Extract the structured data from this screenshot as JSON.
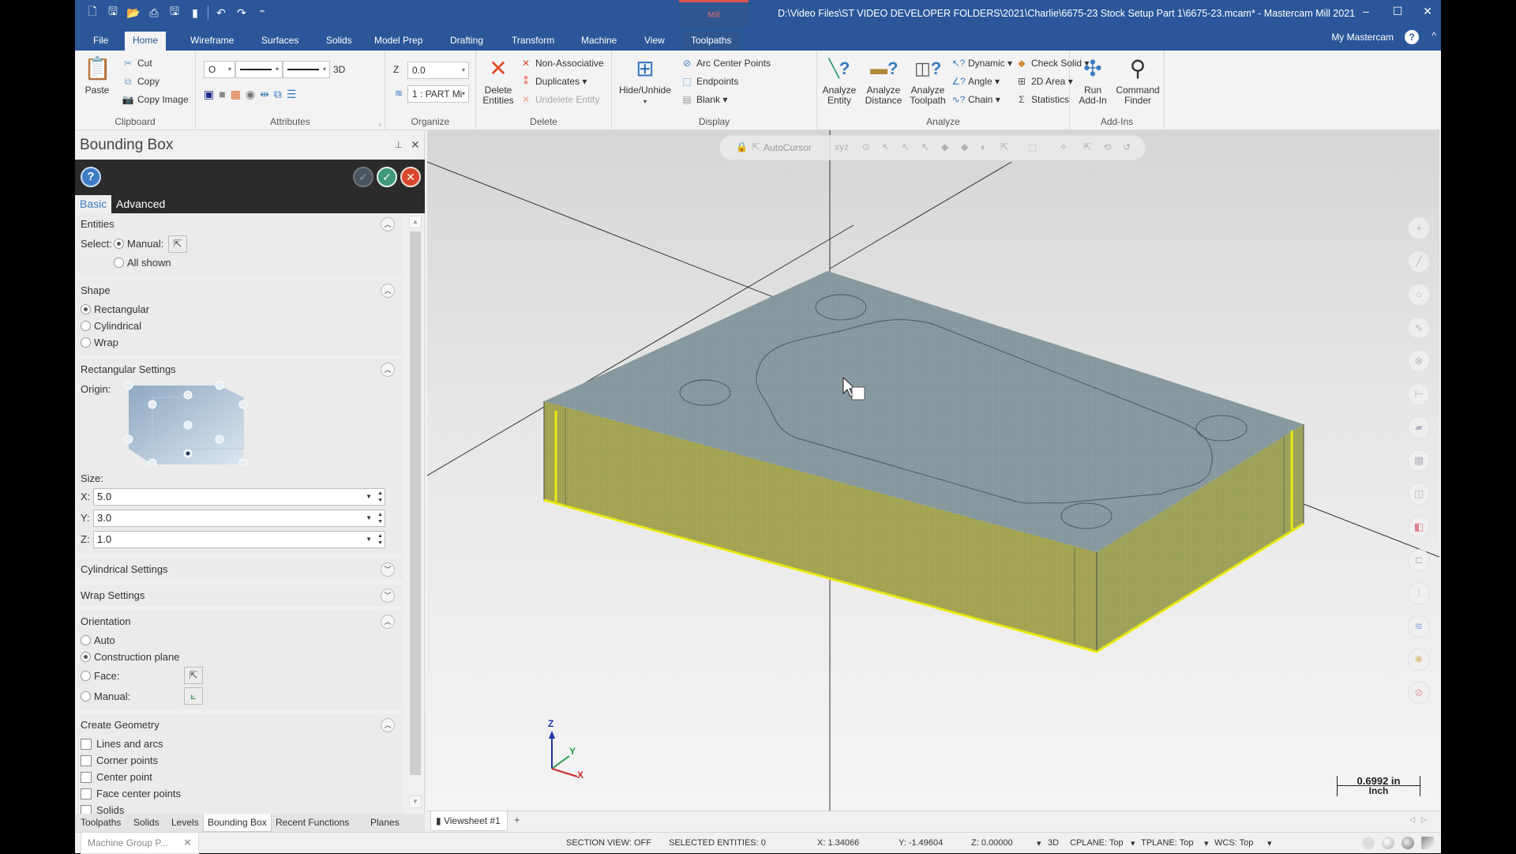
{
  "window": {
    "title": "D:\\Video Files\\ST VIDEO DEVELOPER FOLDERS\\2021\\Charlie\\6675-23 Stock Setup Part 1\\6675-23.mcam* - Mastercam Mill 2021",
    "context_tab": "Mill",
    "minimize": "–",
    "maximize": "☐",
    "close": "✕"
  },
  "quick_access": [
    "new-file-icon",
    "save-icon",
    "open-icon",
    "print-icon",
    "save-as-icon",
    "send-icon",
    "undo-icon",
    "redo-icon",
    "customize-icon"
  ],
  "ribbon_tabs": [
    {
      "label": "File",
      "active": false
    },
    {
      "label": "Home",
      "active": true
    },
    {
      "label": "Wireframe",
      "active": false
    },
    {
      "label": "Surfaces",
      "active": false
    },
    {
      "label": "Solids",
      "active": false
    },
    {
      "label": "Model Prep",
      "active": false
    },
    {
      "label": "Drafting",
      "active": false
    },
    {
      "label": "Transform",
      "active": false
    },
    {
      "label": "Machine",
      "active": false
    },
    {
      "label": "View",
      "active": false
    },
    {
      "label": "Toolpaths",
      "active": false
    }
  ],
  "ribbon_right": {
    "my_mastercam": "My Mastercam",
    "help": "?",
    "collapse": "^"
  },
  "ribbon": {
    "clipboard": {
      "label": "Clipboard",
      "paste": "Paste",
      "cut": "Cut",
      "copy": "Copy",
      "copy_image": "Copy Image"
    },
    "attributes": {
      "label": "Attributes",
      "point_style": "O",
      "dimension_mode": "3D"
    },
    "organize": {
      "label": "Organize",
      "z_label": "Z",
      "z_value": "0.0",
      "level_value": "1 : PART Mi"
    },
    "delete": {
      "label": "Delete",
      "delete_entities": "Delete Entities",
      "non_associative": "Non-Associative",
      "duplicates": "Duplicates",
      "undelete": "Undelete Entity"
    },
    "display": {
      "label": "Display",
      "hide_unhide": "Hide/Unhide",
      "arc_center": "Arc Center Points",
      "endpoints": "Endpoints",
      "blank": "Blank"
    },
    "analyze": {
      "label": "Analyze",
      "entity": "Analyze Entity",
      "distance": "Analyze Distance",
      "toolpath": "Analyze Toolpath",
      "dynamic": "Dynamic",
      "angle": "Angle",
      "chain": "Chain",
      "check_solid": "Check Solid",
      "area_2d": "2D Area",
      "statistics": "Statistics"
    },
    "addins": {
      "label": "Add-Ins",
      "run_addin": "Run Add-In",
      "command_finder": "Command Finder"
    }
  },
  "panel": {
    "title": "Bounding Box",
    "pin": "⊥",
    "close": "✕",
    "help": "?",
    "tabs": [
      {
        "label": "Basic",
        "active": true
      },
      {
        "label": "Advanced",
        "active": false
      }
    ],
    "entities": {
      "title": "Entities",
      "select_label": "Select:",
      "manual": "Manual:",
      "all_shown": "All shown",
      "selected": "manual"
    },
    "shape": {
      "title": "Shape",
      "options": [
        "Rectangular",
        "Cylindrical",
        "Wrap"
      ],
      "selected": "Rectangular"
    },
    "rectangular": {
      "title": "Rectangular Settings",
      "origin_label": "Origin:",
      "size_label": "Size:",
      "x_label": "X:",
      "x_value": "5.0",
      "y_label": "Y:",
      "y_value": "3.0",
      "z_label": "Z:",
      "z_value": "1.0"
    },
    "cylindrical": {
      "title": "Cylindrical Settings",
      "expanded": false
    },
    "wrap": {
      "title": "Wrap Settings",
      "expanded": false
    },
    "orientation": {
      "title": "Orientation",
      "options": [
        "Auto",
        "Construction plane",
        "Face:",
        "Manual:"
      ],
      "selected": "Construction plane"
    },
    "create_geometry": {
      "title": "Create Geometry",
      "options": [
        {
          "label": "Lines and arcs",
          "checked": false
        },
        {
          "label": "Corner points",
          "checked": false
        },
        {
          "label": "Center point",
          "checked": false
        },
        {
          "label": "Face center points",
          "checked": false
        },
        {
          "label": "Solids",
          "checked": false
        }
      ]
    }
  },
  "bottom_tabs": [
    {
      "label": "Toolpaths",
      "active": false
    },
    {
      "label": "Solids",
      "active": false
    },
    {
      "label": "Levels",
      "active": false
    },
    {
      "label": "Bounding Box",
      "active": true
    },
    {
      "label": "Recent Functions",
      "active": false
    },
    {
      "label": "Planes",
      "active": false
    }
  ],
  "viewport": {
    "autocursor": "AutoCursor",
    "right_toolbar": [
      "point-icon",
      "line-icon",
      "circle-icon",
      "spline-icon",
      "solid-icon",
      "dimension-icon",
      "surface-icon",
      "box-icon",
      "plane-icon",
      "color-icon",
      "level-icon",
      "attribute-icon",
      "layers-icon",
      "settings-icon",
      "clear-icon"
    ],
    "scale_value": "0.6992 in",
    "scale_unit": "Inch",
    "axes": {
      "x": "X",
      "y": "Y",
      "z": "Z"
    }
  },
  "viewsheet": {
    "tab": "Viewsheet #1",
    "add": "+"
  },
  "status": {
    "machine_group": "Machine Group P...",
    "section_view": "SECTION VIEW: OFF",
    "selected_entities": "SELECTED ENTITIES: 0",
    "x": "X:  1.34066",
    "y": "Y:  -1.49604",
    "z": "Z:  0.00000",
    "mode": "3D",
    "cplane": "CPLANE: Top",
    "tplane": "TPLANE: Top",
    "wcs": "WCS: Top"
  },
  "colors": {
    "accent": "#2b579a",
    "ok": "#3e9a7a",
    "cancel": "#d9472f",
    "selection": "#f2f20a"
  }
}
